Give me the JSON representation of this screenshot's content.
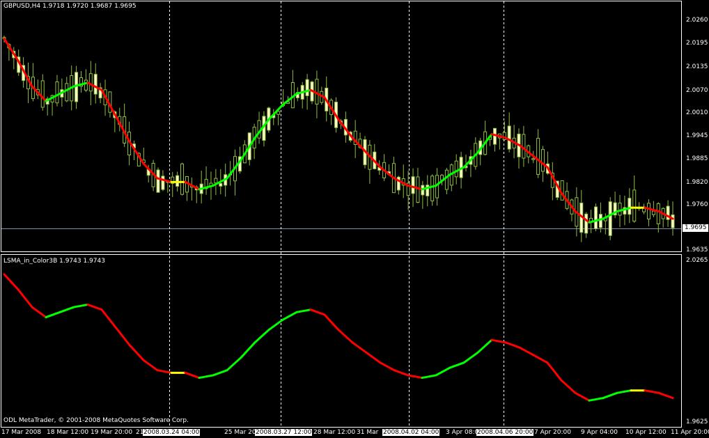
{
  "main_chart": {
    "title": "GBPUSD,H4  1.9718 1.9720 1.9687 1.9695",
    "current_price": "1.9695",
    "price_labels": [
      "2.0260",
      "2.0195",
      "2.0135",
      "2.0070",
      "2.0010",
      "1.9945",
      "1.9885",
      "1.9820",
      "1.9760",
      "1.9635"
    ]
  },
  "indicator": {
    "title": "LSMA_in_Color3B 1.9743 1.9743",
    "price_labels": [
      "2.0265",
      "1.9625"
    ]
  },
  "time_axis": {
    "labels": [
      "17 Mar 2008",
      "18 Mar 12:00",
      "19 Mar 20:00",
      "21",
      "25 Mar 20",
      "28 Mar 12:00",
      "31 Mar",
      "3 Apr 08:0",
      "7 Apr 20:00",
      "9 Apr 04:00",
      "10 Apr 12:00",
      "11 Apr 20:00"
    ],
    "highlighted": [
      "2008.03.24 04:00",
      "2008.03.27 12:00",
      "2008.04.02 04:00",
      "2008.04.06 20:00"
    ]
  },
  "copyright": "ODL MetaTrader, © 2001-2008 MetaQuotes Software Corp.",
  "colors": {
    "up": "#00ff00",
    "down": "#ff0000",
    "neutral": "#ffff00",
    "candle": "#8fbf3f",
    "grid": "#ffffff"
  },
  "chart_data": {
    "type": "line",
    "series": [
      {
        "values": [
          2.021,
          2.015,
          2.008,
          2.004,
          2.006,
          2.008,
          2.009,
          2.007,
          2.0,
          1.993,
          1.987,
          1.983,
          1.982,
          1.982,
          1.98,
          1.981,
          1.983,
          1.988,
          1.994,
          1.999,
          2.003,
          2.006,
          2.007,
          2.005,
          1.999,
          1.994,
          1.99,
          1.986,
          1.983,
          1.981,
          1.98,
          1.981,
          1.984,
          1.986,
          1.99,
          1.995,
          1.994,
          1.992,
          1.989,
          1.986,
          1.979,
          1.974,
          1.971,
          1.972,
          1.974,
          1.975,
          1.975,
          1.974,
          1.972
        ]
      }
    ]
  }
}
